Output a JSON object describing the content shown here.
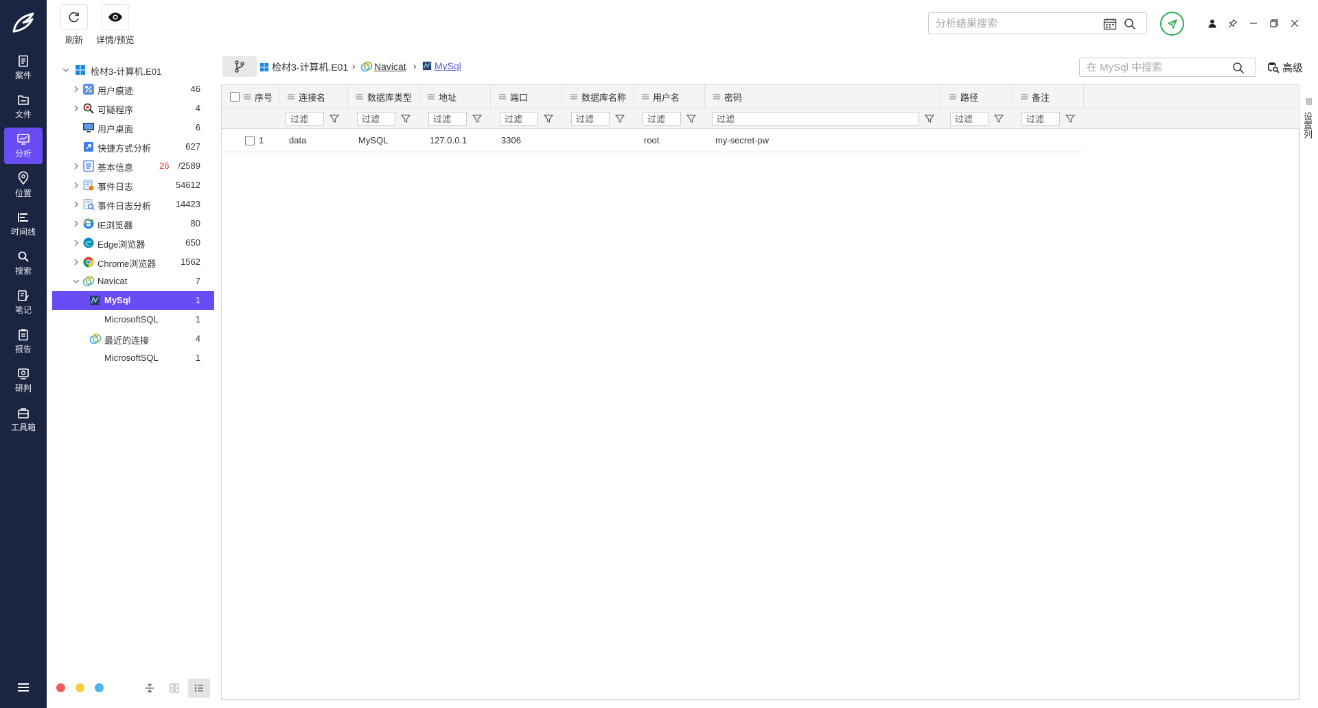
{
  "rail": {
    "items": [
      {
        "label": "案件",
        "icon": "case-icon"
      },
      {
        "label": "文件",
        "icon": "file-icon"
      },
      {
        "label": "分析",
        "icon": "analysis-icon",
        "active": true
      },
      {
        "label": "位置",
        "icon": "location-icon"
      },
      {
        "label": "时间线",
        "icon": "timeline-icon"
      },
      {
        "label": "搜索",
        "icon": "search-icon"
      },
      {
        "label": "笔记",
        "icon": "note-icon"
      },
      {
        "label": "报告",
        "icon": "report-icon"
      },
      {
        "label": "研判",
        "icon": "judgement-icon"
      },
      {
        "label": "工具箱",
        "icon": "toolbox-icon"
      }
    ],
    "active_color": "#6a4cf5",
    "background": "#1b2440"
  },
  "toolbar": {
    "refresh_label": "刷新",
    "detail_label": "详情/预览"
  },
  "top_search": {
    "placeholder": "分析结果搜索"
  },
  "tree": {
    "root": {
      "label": "检材3-计算机.E01"
    },
    "items": [
      {
        "label": "用户痕迹",
        "count": "46"
      },
      {
        "label": "可疑程序",
        "count": "4"
      },
      {
        "label": "用户桌面",
        "count": "6"
      },
      {
        "label": "快捷方式分析",
        "count": "627"
      },
      {
        "label": "基本信息",
        "count_red": "26",
        "count": "/2589"
      },
      {
        "label": "事件日志",
        "count": "54612"
      },
      {
        "label": "事件日志分析",
        "count": "14423"
      },
      {
        "label": "IE浏览器",
        "count": "80"
      },
      {
        "label": "Edge浏览器",
        "count": "650"
      },
      {
        "label": "Chrome浏览器",
        "count": "1562"
      },
      {
        "label": "Navicat",
        "count": "7"
      },
      {
        "label": "MySql",
        "count": "1"
      },
      {
        "label": "MicrosoftSQL",
        "count": "1"
      },
      {
        "label": "最近的连接",
        "count": "4"
      },
      {
        "label": "MicrosoftSQL",
        "count": "1"
      }
    ],
    "selected": "MySql"
  },
  "breadcrumb": [
    "检材3-计算机.E01",
    "Navicat",
    "MySql"
  ],
  "grid_search": {
    "placeholder": "在 MySql 中搜索"
  },
  "advanced_label": "高级",
  "grid": {
    "columns": [
      "序号",
      "连接名",
      "数据库类型",
      "地址",
      "端口",
      "数据库名称",
      "用户名",
      "密码",
      "路径",
      "备注"
    ],
    "filter_placeholder": "过滤",
    "rows": [
      {
        "index": "1",
        "name": "data",
        "db_type": "MySQL",
        "address": "127.0.0.1",
        "port": "3306",
        "db_name": "",
        "user": "root",
        "password": "my-secret-pw",
        "path": "",
        "note": ""
      }
    ]
  },
  "column_settings_label": "设置列"
}
